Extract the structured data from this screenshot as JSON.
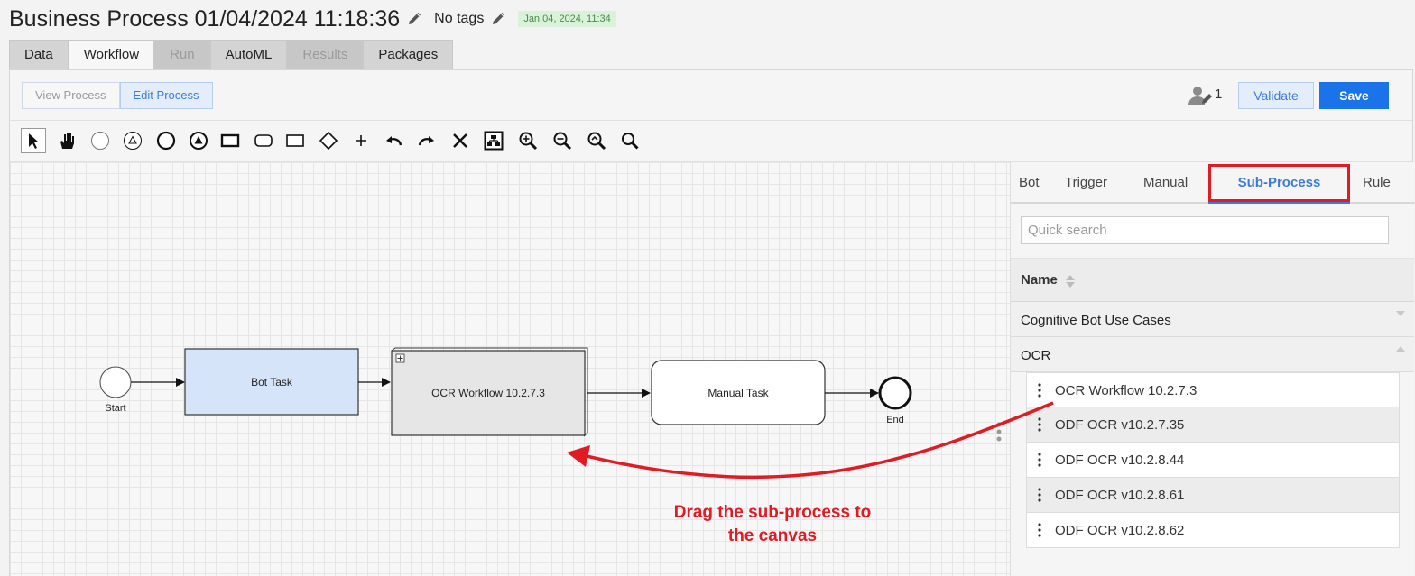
{
  "header": {
    "title": "Business Process 01/04/2024 11:18:36",
    "tags": "No tags",
    "date_badge": "Jan 04, 2024, 11:34"
  },
  "tabs": [
    {
      "label": "Data",
      "state": "normal"
    },
    {
      "label": "Workflow",
      "state": "active"
    },
    {
      "label": "Run",
      "state": "disabled"
    },
    {
      "label": "AutoML",
      "state": "normal"
    },
    {
      "label": "Results",
      "state": "disabled"
    },
    {
      "label": "Packages",
      "state": "normal"
    }
  ],
  "topbar": {
    "view_process": "View Process",
    "edit_process": "Edit Process",
    "user_count": "1",
    "validate": "Validate",
    "save": "Save"
  },
  "toolbar_icons": [
    "pointer-icon",
    "hand-icon",
    "circle-icon",
    "triangle-circle-icon",
    "bold-circle-icon",
    "filled-triangle-circle-icon",
    "rectangle-icon",
    "rounded-rectangle-icon",
    "thin-rectangle-icon",
    "diamond-icon",
    "plus-icon",
    "undo-icon",
    "redo-icon",
    "delete-icon",
    "layout-icon",
    "zoom-in-icon",
    "zoom-out-icon",
    "zoom-fit-icon",
    "zoom-icon"
  ],
  "diagram": {
    "start_label": "Start",
    "bot_task": "Bot Task",
    "subprocess": "OCR Workflow 10.2.7.3",
    "manual_task": "Manual Task",
    "end_label": "End"
  },
  "sidepanel": {
    "tabs": [
      "Bot",
      "Trigger",
      "Manual",
      "Sub-Process",
      "Rule"
    ],
    "active_tab": "Sub-Process",
    "search_placeholder": "Quick search",
    "column_header": "Name",
    "groups": [
      "Cognitive Bot Use Cases",
      "OCR"
    ],
    "items": [
      "OCR Workflow 10.2.7.3",
      "ODF OCR v10.2.7.35",
      "ODF OCR v10.2.8.44",
      "ODF OCR v10.2.8.61",
      "ODF OCR v10.2.8.62"
    ]
  },
  "annotation": {
    "line1": "Drag the sub-process to",
    "line2": "the canvas",
    "color": "#e01b24"
  },
  "colors": {
    "accent": "#1a73e8",
    "bot_task_fill": "#d6e4fa",
    "subprocess_fill": "#e6e6e6",
    "date_badge_bg": "#d9f2d9"
  }
}
